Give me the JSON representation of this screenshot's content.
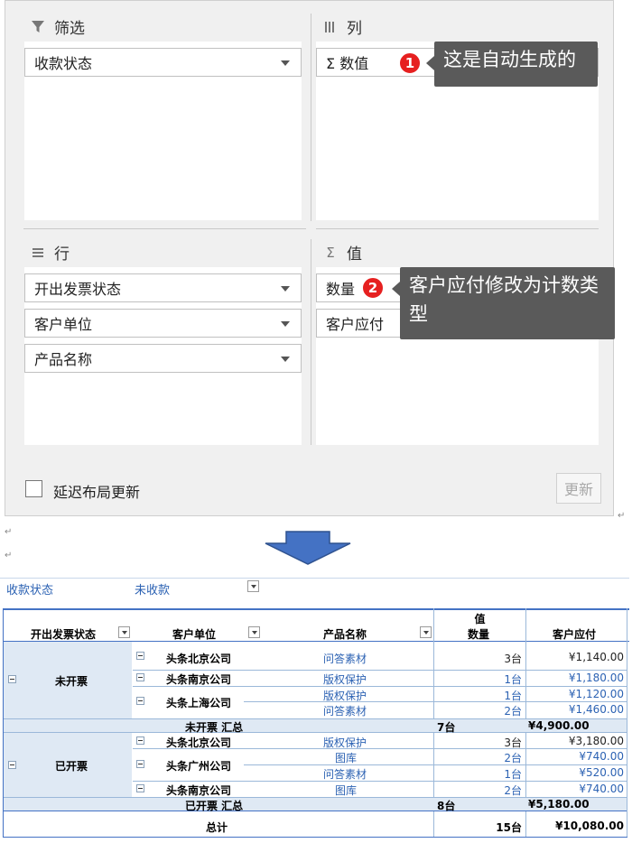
{
  "pane": {
    "filters": {
      "title": "筛选",
      "fields": [
        "收款状态"
      ]
    },
    "columns": {
      "title": "列",
      "fields": [
        "Σ 数值"
      ]
    },
    "rows": {
      "title": "行",
      "fields": [
        "开出发票状态",
        "客户单位",
        "产品名称"
      ]
    },
    "values": {
      "title": "值",
      "fields": [
        "数量",
        "客户应付"
      ]
    },
    "callout1": {
      "badge": "1",
      "text": "这是自动生成的"
    },
    "callout2": {
      "badge": "2",
      "text": "客户应付修改为计数类型"
    },
    "defer_label": "延迟布局更新",
    "update_button": "更新"
  },
  "pivot": {
    "filter_label": "收款状态",
    "filter_value": "未收款",
    "values_caption": "值",
    "headers": [
      "开出发票状态",
      "客户单位",
      "产品名称",
      "数量",
      "客户应付"
    ],
    "rows": [
      {
        "status": "未开票",
        "customer": "头条北京公司",
        "product": "问答素材",
        "qty": "3台",
        "pay": "¥1,140.00"
      },
      {
        "status": "",
        "customer": "头条南京公司",
        "product": "版权保护",
        "qty": "1台",
        "pay": "¥1,180.00"
      },
      {
        "status": "",
        "customer": "头条上海公司",
        "product": "版权保护",
        "qty": "1台",
        "pay": "¥1,120.00"
      },
      {
        "status": "",
        "customer": "",
        "product": "问答素材",
        "qty": "2台",
        "pay": "¥1,460.00"
      },
      {
        "subtotal": "未开票 汇总",
        "qty": "7台",
        "pay": "¥4,900.00"
      },
      {
        "status": "已开票",
        "customer": "头条北京公司",
        "product": "版权保护",
        "qty": "3台",
        "pay": "¥3,180.00"
      },
      {
        "status": "",
        "customer": "头条广州公司",
        "product": "图库",
        "qty": "2台",
        "pay": "¥740.00"
      },
      {
        "status": "",
        "customer": "",
        "product": "问答素材",
        "qty": "1台",
        "pay": "¥520.00"
      },
      {
        "status": "",
        "customer": "头条南京公司",
        "product": "图库",
        "qty": "2台",
        "pay": "¥740.00"
      },
      {
        "subtotal": "已开票 汇总",
        "qty": "8台",
        "pay": "¥5,180.00"
      }
    ],
    "total_label": "总计",
    "total_qty": "15台",
    "total_pay": "¥10,080.00"
  },
  "colors": {
    "accent_blue": "#4472c4",
    "badge_red": "#e62020",
    "callout_bg": "#5a5a5a"
  }
}
